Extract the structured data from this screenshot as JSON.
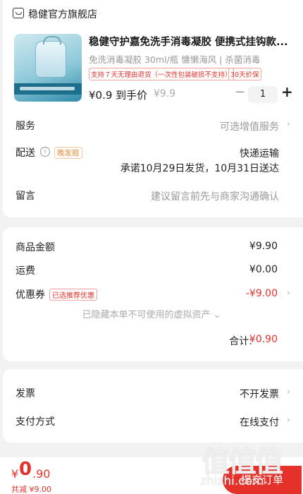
{
  "store": {
    "name": "稳健官方旗舰店",
    "icon": "store-icon"
  },
  "product": {
    "title": "稳健守护嘉免洗手消毒凝胶 便携式挂钩款...",
    "spec": "免洗消毒凝胶 30ml/瓶 慵懒海风 | 杀菌消毒",
    "tag_return": "支持７天无理由退货（一次性包装破损不支持）",
    "tag_price": "30天价保",
    "price": "¥0.9 到手价",
    "original_price": "¥9.9",
    "quantity": "1",
    "minus_symbol": "−",
    "plus_symbol": "+"
  },
  "service": {
    "label": "服务",
    "value": "可选增值服务"
  },
  "delivery": {
    "label": "配送",
    "late_tag": "晚发赔",
    "method": "快递运输",
    "promise": "承诺10月29日发货，10月31日送达"
  },
  "message": {
    "label": "留言",
    "placeholder": "建议留言前先与商家沟通确认"
  },
  "summary": {
    "goods_label": "商品金额",
    "goods_amount": "¥9.90",
    "freight_label": "运费",
    "freight_amount": "¥0.00",
    "coupon_label": "优惠券",
    "coupon_tag": "已选推荐优惠",
    "coupon_amount": "-¥9.00",
    "hidden_note": "已隐藏本单不可使用的虚拟资产 ⌄",
    "total_label": "合计:",
    "total_amount": "¥0.90"
  },
  "invoice": {
    "label": "发票",
    "value": "不开发票"
  },
  "payment": {
    "label": "支付方式",
    "value": "在线支付"
  },
  "footer": {
    "currency": "¥",
    "amount_main": "0",
    "amount_cents": ".90",
    "saved": "共减 ¥9.00",
    "submit": "提交订单"
  },
  "watermark": {
    "text": "值值值",
    "url": "zhizhi.com"
  },
  "colors": {
    "accent": "#e4312a",
    "orange": "#e98a3a"
  },
  "chevron": "›"
}
